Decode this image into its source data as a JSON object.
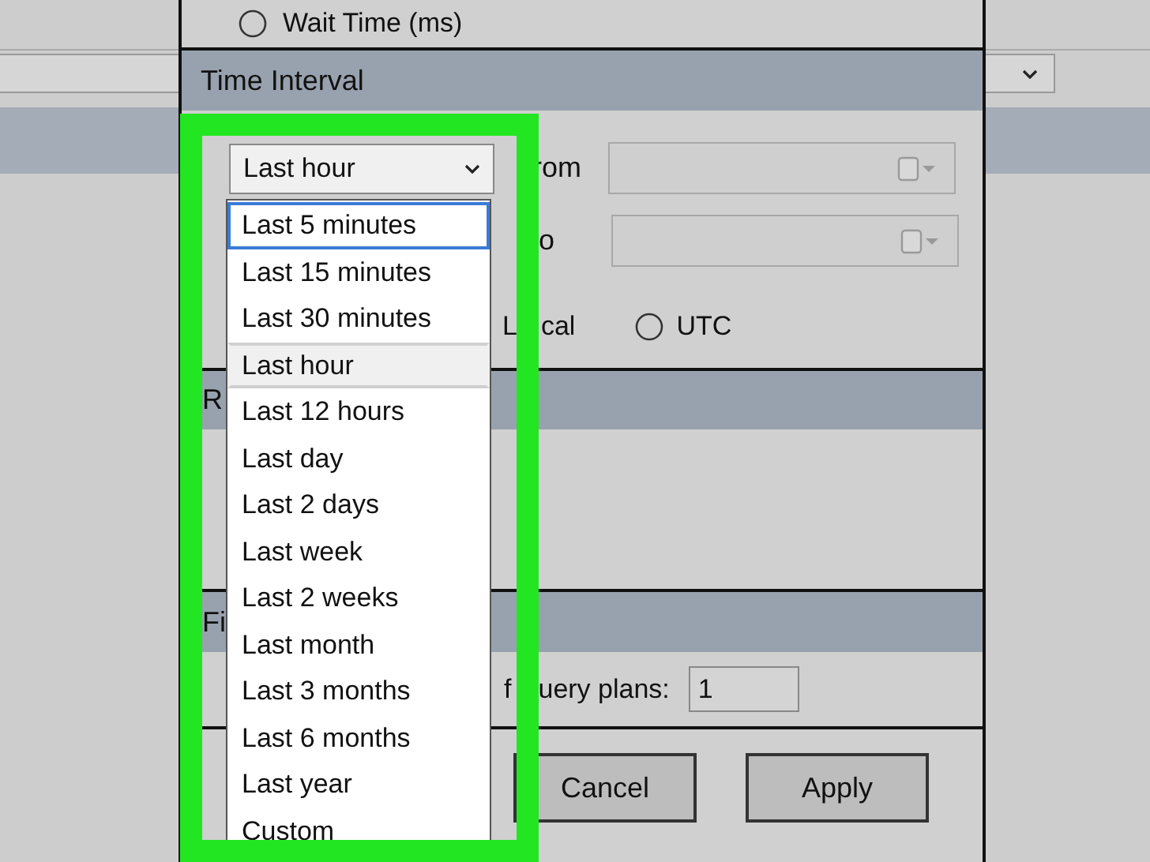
{
  "dialog": {
    "options": [
      {
        "label": "Wait Time (ms)",
        "selected": false
      }
    ],
    "sections": [
      {
        "title": "Time Interval"
      },
      {
        "title": "R"
      },
      {
        "title": "Fi"
      }
    ],
    "time_interval": {
      "range": "Last hour",
      "from_label": "rom",
      "to_label": "o",
      "time_zones": [
        {
          "parts": [
            "L",
            "cal"
          ],
          "kind": "text"
        },
        {
          "label": "UTC",
          "kind": "radio",
          "selected": false
        }
      ]
    },
    "query_plans": {
      "label_parts": [
        "f",
        "uery plans:"
      ],
      "value": "1"
    },
    "buttons": [
      "Cancel",
      "Apply"
    ]
  },
  "dropdown": {
    "items": [
      {
        "label": "Last 5 minutes",
        "selected": false,
        "focused": true
      },
      {
        "label": "Last 15 minutes",
        "selected": false,
        "focused": false
      },
      {
        "label": "Last 30 minutes",
        "selected": false,
        "focused": false
      },
      {
        "label": "Last hour",
        "selected": true,
        "focused": false
      },
      {
        "label": "Last 12 hours",
        "selected": false,
        "focused": false
      },
      {
        "label": "Last day",
        "selected": false,
        "focused": false
      },
      {
        "label": "Last 2 days",
        "selected": false,
        "focused": false
      },
      {
        "label": "Last week",
        "selected": false,
        "focused": false
      },
      {
        "label": "Last 2 weeks",
        "selected": false,
        "focused": false
      },
      {
        "label": "Last month",
        "selected": false,
        "focused": false
      },
      {
        "label": "Last 3 months",
        "selected": false,
        "focused": false
      },
      {
        "label": "Last 6 months",
        "selected": false,
        "focused": false
      },
      {
        "label": "Last year",
        "selected": false,
        "focused": false
      },
      {
        "label": "Custom",
        "selected": false,
        "focused": false
      }
    ]
  }
}
